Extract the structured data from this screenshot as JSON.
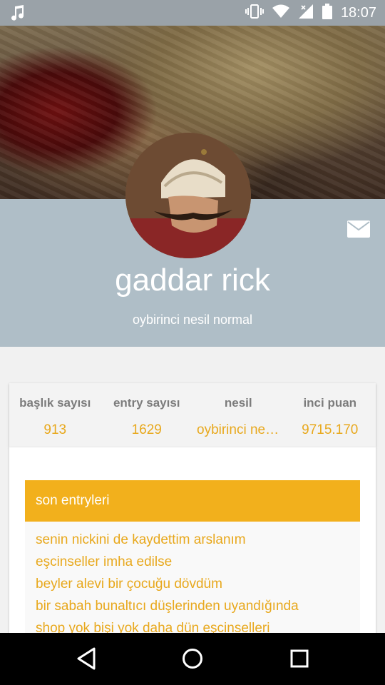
{
  "status_bar": {
    "time": "18:07",
    "icons": [
      "music-note-icon",
      "vibrate-icon",
      "wifi-icon",
      "signal-icon",
      "battery-icon"
    ]
  },
  "profile": {
    "username": "gaddar rick",
    "subtitle": "oybirinci nesil normal"
  },
  "stats": [
    {
      "label": "başlık sayısı",
      "value": "913"
    },
    {
      "label": "entry sayısı",
      "value": "1629"
    },
    {
      "label": "nesil",
      "value": "oybirinci nesi..."
    },
    {
      "label": "inci puan",
      "value": "9715.170"
    }
  ],
  "entries": {
    "header": "son entryleri",
    "items": [
      "senin nickini de kaydettim arslanım",
      "eşcinseller imha edilse",
      "beyler alevi bir çocuğu dövdüm",
      "bir sabah bunaltıcı düşlerinden uyandığında",
      "shop yok bişi yok daha dün eşcinselleri"
    ]
  },
  "colors": {
    "accent": "#f2b01c",
    "accent_text": "#e8a81c",
    "header_band": "#afbec7",
    "status_bar": "#9aa2a8"
  }
}
